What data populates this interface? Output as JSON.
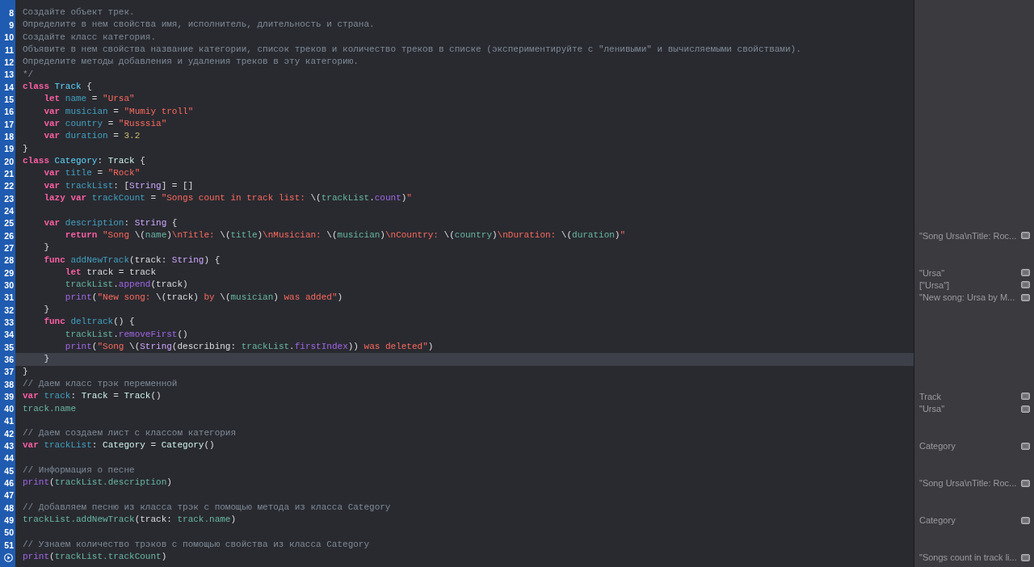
{
  "lines": [
    {
      "number": "8",
      "highlighted": false,
      "tokens": [
        {
          "text": "Создайте объект трек.",
          "kind": "comment"
        }
      ]
    },
    {
      "number": "9",
      "highlighted": false,
      "tokens": [
        {
          "text": "Определите в нем свойства имя, исполнитель, длительность и страна.",
          "kind": "comment"
        }
      ]
    },
    {
      "number": "10",
      "highlighted": false,
      "tokens": [
        {
          "text": "Создайте класс категория.",
          "kind": "comment"
        }
      ]
    },
    {
      "number": "11",
      "highlighted": false,
      "tokens": [
        {
          "text": "Объявите в нем свойства название категории, список треков и количество треков в списке (экспериментируйте с \"ленивыми\" и вычисляемыми свойствами).",
          "kind": "comment"
        }
      ]
    },
    {
      "number": "12",
      "highlighted": false,
      "tokens": [
        {
          "text": "Определите методы добавления и удаления треков в эту категорию.",
          "kind": "comment"
        }
      ]
    },
    {
      "number": "13",
      "highlighted": false,
      "tokens": [
        {
          "text": "*/",
          "kind": "comment"
        }
      ]
    },
    {
      "number": "14",
      "highlighted": false,
      "tokens": [
        {
          "text": "class",
          "kind": "keyword"
        },
        {
          "text": " Track",
          "kind": "class"
        },
        {
          "text": " {",
          "kind": "plain"
        }
      ]
    },
    {
      "number": "15",
      "highlighted": false,
      "tokens": [
        {
          "text": "    let",
          "kind": "keyword"
        },
        {
          "text": " name",
          "kind": "decl"
        },
        {
          "text": " = ",
          "kind": "plain"
        },
        {
          "text": "\"Ursa\"",
          "kind": "string"
        }
      ]
    },
    {
      "number": "16",
      "highlighted": false,
      "tokens": [
        {
          "text": "    var",
          "kind": "keyword"
        },
        {
          "text": " musician",
          "kind": "decl"
        },
        {
          "text": " = ",
          "kind": "plain"
        },
        {
          "text": "\"Mumiy troll\"",
          "kind": "string"
        }
      ]
    },
    {
      "number": "17",
      "highlighted": false,
      "tokens": [
        {
          "text": "    var",
          "kind": "keyword"
        },
        {
          "text": " country",
          "kind": "decl"
        },
        {
          "text": " = ",
          "kind": "plain"
        },
        {
          "text": "\"Russsia\"",
          "kind": "string"
        }
      ]
    },
    {
      "number": "18",
      "highlighted": false,
      "tokens": [
        {
          "text": "    var",
          "kind": "keyword"
        },
        {
          "text": " duration",
          "kind": "decl"
        },
        {
          "text": " = ",
          "kind": "plain"
        },
        {
          "text": "3.2",
          "kind": "number"
        }
      ]
    },
    {
      "number": "19",
      "highlighted": false,
      "tokens": [
        {
          "text": "}",
          "kind": "plain"
        }
      ]
    },
    {
      "number": "20",
      "highlighted": false,
      "tokens": [
        {
          "text": "class",
          "kind": "keyword"
        },
        {
          "text": " Category",
          "kind": "class"
        },
        {
          "text": ": ",
          "kind": "plain"
        },
        {
          "text": "Track",
          "kind": "ptype"
        },
        {
          "text": " {",
          "kind": "plain"
        }
      ]
    },
    {
      "number": "21",
      "highlighted": false,
      "tokens": [
        {
          "text": "    var",
          "kind": "keyword"
        },
        {
          "text": " title",
          "kind": "decl"
        },
        {
          "text": " = ",
          "kind": "plain"
        },
        {
          "text": "\"Rock\"",
          "kind": "string"
        }
      ]
    },
    {
      "number": "22",
      "highlighted": false,
      "tokens": [
        {
          "text": "    var",
          "kind": "keyword"
        },
        {
          "text": " trackList",
          "kind": "decl"
        },
        {
          "text": ": [",
          "kind": "plain"
        },
        {
          "text": "String",
          "kind": "systype"
        },
        {
          "text": "] = []",
          "kind": "plain"
        }
      ]
    },
    {
      "number": "23",
      "highlighted": false,
      "tokens": [
        {
          "text": "    lazy var",
          "kind": "keyword"
        },
        {
          "text": " trackCount",
          "kind": "decl"
        },
        {
          "text": " = ",
          "kind": "plain"
        },
        {
          "text": "\"Songs count in track list: ",
          "kind": "string"
        },
        {
          "text": "\\(",
          "kind": "plain"
        },
        {
          "text": "trackList",
          "kind": "ref"
        },
        {
          "text": ".",
          "kind": "plain"
        },
        {
          "text": "count",
          "kind": "sys"
        },
        {
          "text": ")",
          "kind": "plain"
        },
        {
          "text": "\"",
          "kind": "string"
        }
      ]
    },
    {
      "number": "24",
      "highlighted": false
    },
    {
      "number": "25",
      "highlighted": false,
      "tokens": [
        {
          "text": "    var",
          "kind": "keyword"
        },
        {
          "text": " description",
          "kind": "decl"
        },
        {
          "text": ": ",
          "kind": "plain"
        },
        {
          "text": "String",
          "kind": "systype"
        },
        {
          "text": " {",
          "kind": "plain"
        }
      ]
    },
    {
      "number": "26",
      "highlighted": false,
      "result": "\"Song Ursa\\nTitle: Roc...",
      "tokens": [
        {
          "text": "        return",
          "kind": "keyword"
        },
        {
          "text": " \"Song ",
          "kind": "string"
        },
        {
          "text": "\\(",
          "kind": "plain"
        },
        {
          "text": "name",
          "kind": "ref"
        },
        {
          "text": ")",
          "kind": "plain"
        },
        {
          "text": "\\nTitle: ",
          "kind": "string"
        },
        {
          "text": "\\(",
          "kind": "plain"
        },
        {
          "text": "title",
          "kind": "ref"
        },
        {
          "text": ")",
          "kind": "plain"
        },
        {
          "text": "\\nMusician: ",
          "kind": "string"
        },
        {
          "text": "\\(",
          "kind": "plain"
        },
        {
          "text": "musician",
          "kind": "ref"
        },
        {
          "text": ")",
          "kind": "plain"
        },
        {
          "text": "\\nCountry: ",
          "kind": "string"
        },
        {
          "text": "\\(",
          "kind": "plain"
        },
        {
          "text": "country",
          "kind": "ref"
        },
        {
          "text": ")",
          "kind": "plain"
        },
        {
          "text": "\\nDuration: ",
          "kind": "string"
        },
        {
          "text": "\\(",
          "kind": "plain"
        },
        {
          "text": "duration",
          "kind": "ref"
        },
        {
          "text": ")",
          "kind": "plain"
        },
        {
          "text": "\"",
          "kind": "string"
        }
      ]
    },
    {
      "number": "27",
      "highlighted": false,
      "tokens": [
        {
          "text": "    }",
          "kind": "plain"
        }
      ]
    },
    {
      "number": "28",
      "highlighted": false,
      "tokens": [
        {
          "text": "    func",
          "kind": "keyword"
        },
        {
          "text": " addNewTrack",
          "kind": "decl"
        },
        {
          "text": "(track: ",
          "kind": "plain"
        },
        {
          "text": "String",
          "kind": "systype"
        },
        {
          "text": ") {",
          "kind": "plain"
        }
      ]
    },
    {
      "number": "29",
      "highlighted": false,
      "result": "\"Ursa\"",
      "tokens": [
        {
          "text": "        let",
          "kind": "keyword"
        },
        {
          "text": " track = track",
          "kind": "plain"
        }
      ]
    },
    {
      "number": "30",
      "highlighted": false,
      "result": "[\"Ursa\"]",
      "tokens": [
        {
          "text": "        trackList",
          "kind": "ref"
        },
        {
          "text": ".",
          "kind": "plain"
        },
        {
          "text": "append",
          "kind": "sys"
        },
        {
          "text": "(track)",
          "kind": "plain"
        }
      ]
    },
    {
      "number": "31",
      "highlighted": false,
      "result": "\"New song: Ursa by M...",
      "tokens": [
        {
          "text": "        print",
          "kind": "sys"
        },
        {
          "text": "(",
          "kind": "plain"
        },
        {
          "text": "\"New song: ",
          "kind": "string"
        },
        {
          "text": "\\(track)",
          "kind": "plain"
        },
        {
          "text": " by ",
          "kind": "string"
        },
        {
          "text": "\\(",
          "kind": "plain"
        },
        {
          "text": "musician",
          "kind": "ref"
        },
        {
          "text": ")",
          "kind": "plain"
        },
        {
          "text": " was added\"",
          "kind": "string"
        },
        {
          "text": ")",
          "kind": "plain"
        }
      ]
    },
    {
      "number": "32",
      "highlighted": false,
      "tokens": [
        {
          "text": "    }",
          "kind": "plain"
        }
      ]
    },
    {
      "number": "33",
      "highlighted": false,
      "tokens": [
        {
          "text": "    func",
          "kind": "keyword"
        },
        {
          "text": " deltrack",
          "kind": "decl"
        },
        {
          "text": "() {",
          "kind": "plain"
        }
      ]
    },
    {
      "number": "34",
      "highlighted": false,
      "tokens": [
        {
          "text": "        trackList",
          "kind": "ref"
        },
        {
          "text": ".",
          "kind": "plain"
        },
        {
          "text": "removeFirst",
          "kind": "sys"
        },
        {
          "text": "()",
          "kind": "plain"
        }
      ]
    },
    {
      "number": "35",
      "highlighted": false,
      "tokens": [
        {
          "text": "        print",
          "kind": "sys"
        },
        {
          "text": "(",
          "kind": "plain"
        },
        {
          "text": "\"Song ",
          "kind": "string"
        },
        {
          "text": "\\(",
          "kind": "plain"
        },
        {
          "text": "String",
          "kind": "systype"
        },
        {
          "text": "(describing: ",
          "kind": "plain"
        },
        {
          "text": "trackList",
          "kind": "ref"
        },
        {
          "text": ".",
          "kind": "plain"
        },
        {
          "text": "firstIndex",
          "kind": "sys"
        },
        {
          "text": "))",
          "kind": "plain"
        },
        {
          "text": " was deleted\"",
          "kind": "string"
        },
        {
          "text": ")",
          "kind": "plain"
        }
      ]
    },
    {
      "number": "36",
      "highlighted": true,
      "tokens": [
        {
          "text": "    }",
          "kind": "plain"
        }
      ]
    },
    {
      "number": "37",
      "highlighted": false,
      "tokens": [
        {
          "text": "}",
          "kind": "plain"
        }
      ]
    },
    {
      "number": "38",
      "highlighted": false,
      "tokens": [
        {
          "text": "// Даем класс трэк переменной",
          "kind": "comment"
        }
      ]
    },
    {
      "number": "39",
      "highlighted": false,
      "result": "Track",
      "tokens": [
        {
          "text": "var",
          "kind": "keyword"
        },
        {
          "text": " track",
          "kind": "decl"
        },
        {
          "text": ": ",
          "kind": "plain"
        },
        {
          "text": "Track",
          "kind": "ptype"
        },
        {
          "text": " = ",
          "kind": "plain"
        },
        {
          "text": "Track",
          "kind": "ptype"
        },
        {
          "text": "()",
          "kind": "plain"
        }
      ]
    },
    {
      "number": "40",
      "highlighted": false,
      "result": "\"Ursa\"",
      "tokens": [
        {
          "text": "track.name",
          "kind": "ref"
        }
      ]
    },
    {
      "number": "41",
      "highlighted": false
    },
    {
      "number": "42",
      "highlighted": false,
      "tokens": [
        {
          "text": "// Даем создаем лист с классом категория",
          "kind": "comment"
        }
      ]
    },
    {
      "number": "43",
      "highlighted": false,
      "result": "Category",
      "tokens": [
        {
          "text": "var",
          "kind": "keyword"
        },
        {
          "text": " trackList",
          "kind": "decl"
        },
        {
          "text": ": ",
          "kind": "plain"
        },
        {
          "text": "Category",
          "kind": "ptype"
        },
        {
          "text": " = ",
          "kind": "plain"
        },
        {
          "text": "Category",
          "kind": "ptype"
        },
        {
          "text": "()",
          "kind": "plain"
        }
      ]
    },
    {
      "number": "44",
      "highlighted": false
    },
    {
      "number": "45",
      "highlighted": false,
      "tokens": [
        {
          "text": "// Информация о песне",
          "kind": "comment"
        }
      ]
    },
    {
      "number": "46",
      "highlighted": false,
      "result": "\"Song Ursa\\nTitle: Roc...",
      "tokens": [
        {
          "text": "print",
          "kind": "sys"
        },
        {
          "text": "(",
          "kind": "plain"
        },
        {
          "text": "trackList.description",
          "kind": "ref"
        },
        {
          "text": ")",
          "kind": "plain"
        }
      ]
    },
    {
      "number": "47",
      "highlighted": false
    },
    {
      "number": "48",
      "highlighted": false,
      "tokens": [
        {
          "text": "// Добавляем песню из класса трэк с помощью метода из класса Category",
          "kind": "comment"
        }
      ]
    },
    {
      "number": "49",
      "highlighted": false,
      "result": "Category",
      "tokens": [
        {
          "text": "trackList.addNewTrack",
          "kind": "ref"
        },
        {
          "text": "(track: ",
          "kind": "plain"
        },
        {
          "text": "track.name",
          "kind": "ref"
        },
        {
          "text": ")",
          "kind": "plain"
        }
      ]
    },
    {
      "number": "50",
      "highlighted": false
    },
    {
      "number": "51",
      "highlighted": false,
      "tokens": [
        {
          "text": "// Узнаем количество трэков с помощью свойства из класса Category",
          "kind": "comment"
        }
      ]
    },
    {
      "highlighted": false,
      "result": "\"Songs count in track li...",
      "tokens": [
        {
          "text": "print",
          "kind": "sys"
        },
        {
          "text": "(",
          "kind": "plain"
        },
        {
          "text": "trackList.trackCount",
          "kind": "ref"
        },
        {
          "text": ")",
          "kind": "plain"
        }
      ]
    }
  ]
}
